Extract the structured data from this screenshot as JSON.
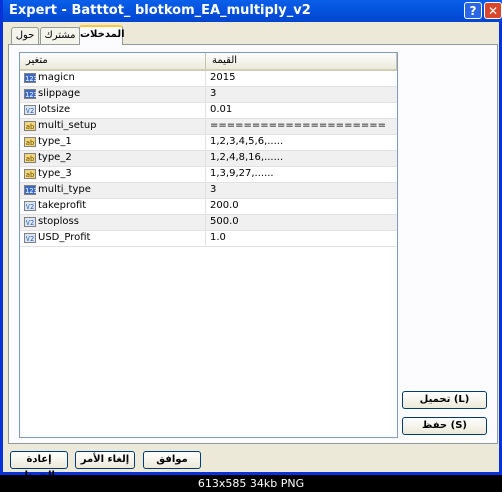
{
  "window": {
    "title": "Expert - Batttot_ blotkom_EA_multiply_v2",
    "help": "?",
    "close": "✕"
  },
  "tabs": [
    {
      "label": "حول"
    },
    {
      "label": "مشترك"
    },
    {
      "label": "المدخلات"
    }
  ],
  "grid": {
    "headers": {
      "variable": "متغير",
      "value": "القيمة"
    },
    "rows": [
      {
        "icon": "123",
        "type": "int",
        "name": "magicn",
        "value": "2015"
      },
      {
        "icon": "123",
        "type": "int",
        "name": "slippage",
        "value": "3"
      },
      {
        "icon": "V2",
        "type": "dbl",
        "name": "lotsize",
        "value": "0.01"
      },
      {
        "icon": "ab",
        "type": "str",
        "name": "multi_setup",
        "value": "====================="
      },
      {
        "icon": "ab",
        "type": "str",
        "name": "type_1",
        "value": "1,2,3,4,5,6,....."
      },
      {
        "icon": "ab",
        "type": "str",
        "name": "type_2",
        "value": "1,2,4,8,16,......"
      },
      {
        "icon": "ab",
        "type": "str",
        "name": "type_3",
        "value": "1,3,9,27,......"
      },
      {
        "icon": "123",
        "type": "int",
        "name": "multi_type",
        "value": "3"
      },
      {
        "icon": "V2",
        "type": "dbl",
        "name": "takeprofit",
        "value": "200.0"
      },
      {
        "icon": "V2",
        "type": "dbl",
        "name": "stoploss",
        "value": "500.0"
      },
      {
        "icon": "V2",
        "type": "dbl",
        "name": "USD_Profit",
        "value": "1.0"
      }
    ]
  },
  "side_buttons": {
    "load": "تحميل (L)",
    "save": "حفظ (S)"
  },
  "bottom_buttons": {
    "reset": "إعادة الضبط",
    "cancel": "إلغاء الأمر",
    "ok": "موافق"
  },
  "footer": {
    "text": "613x585  34kb  PNG"
  }
}
